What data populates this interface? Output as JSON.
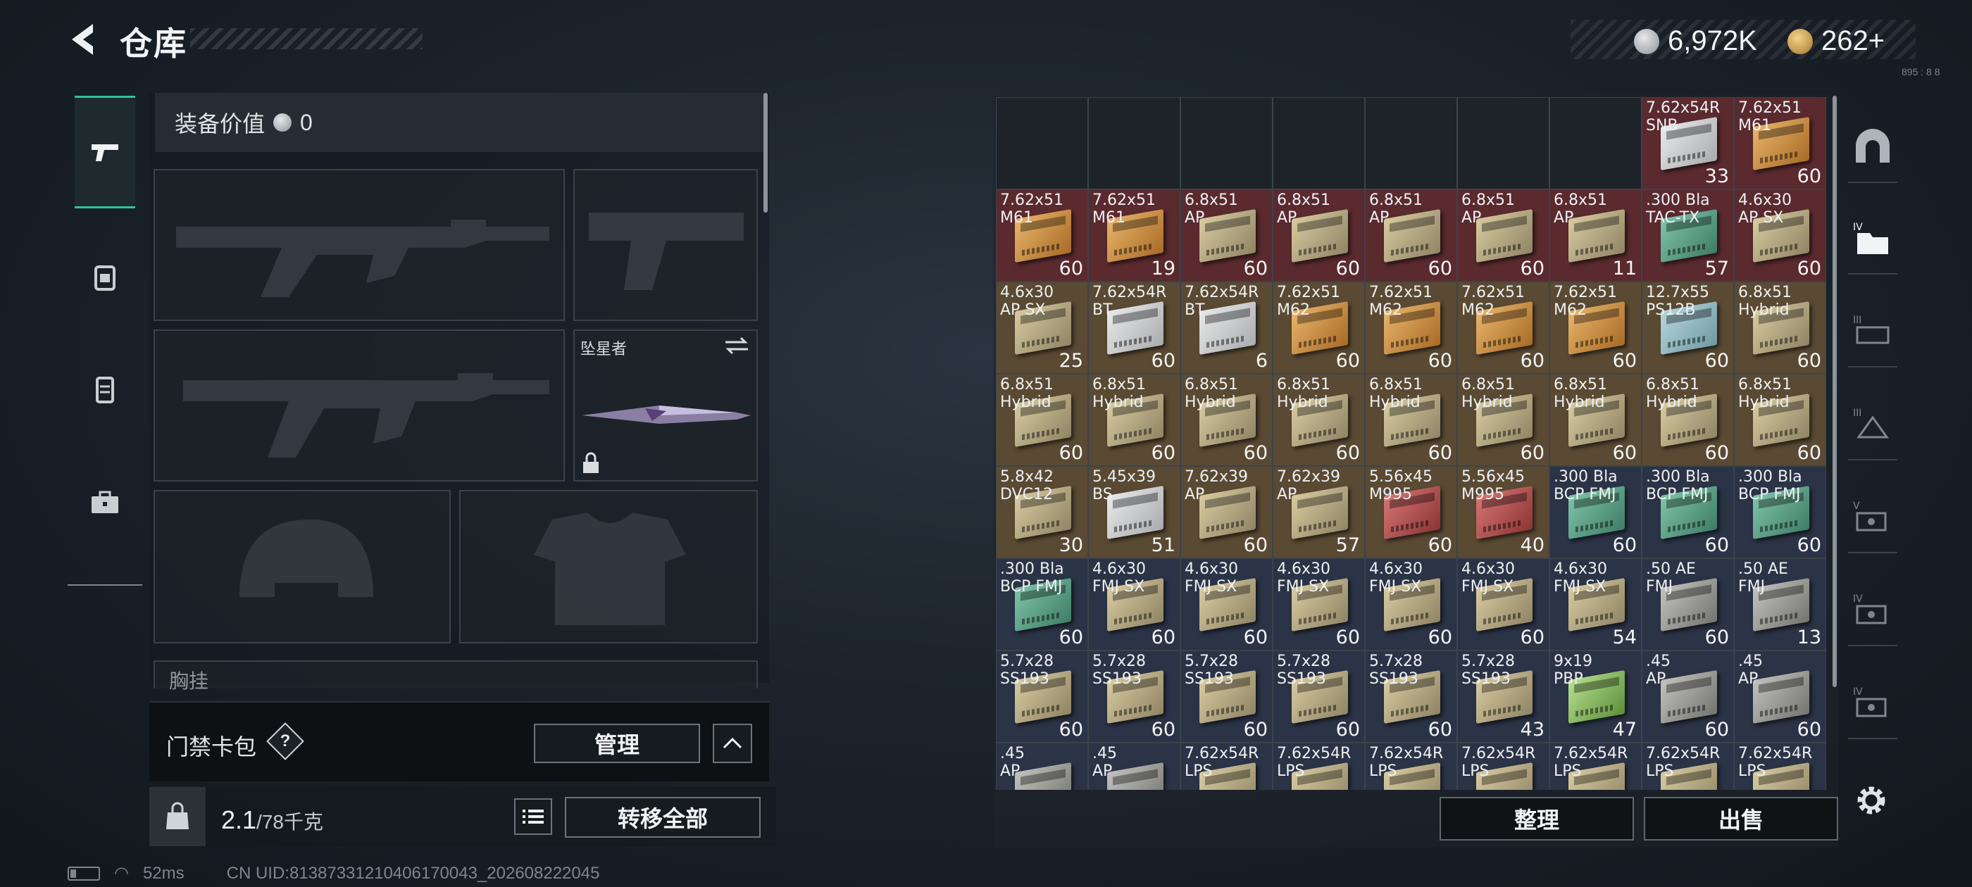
{
  "header": {
    "title": "仓库",
    "currency_silver": "6,972K",
    "currency_gold": "262+",
    "tiny_code": "895 : 8 8"
  },
  "loadout": {
    "value_label": "装备价值",
    "value_amount": "0",
    "melee_name": "坠星者",
    "chest_label": "胸挂",
    "chest_hint": "?"
  },
  "keycard": {
    "label": "门禁卡包",
    "help": "?",
    "manage_label": "管理"
  },
  "weight": {
    "current": "2.1",
    "max": "/78千克",
    "transfer_all_label": "转移全部"
  },
  "status": {
    "ping": "52ms",
    "uid": "CN UID:81387331210406170043_202608222045"
  },
  "stash": {
    "sort_label": "整理",
    "sell_label": "出售",
    "colors": {
      "empty": "#1d2329",
      "red": "#5a2a2e",
      "gold": "#5a4a33",
      "blue": "#2b3346"
    },
    "rows": [
      [
        {
          "name": "",
          "qty": "",
          "bg": "empty",
          "box": ""
        },
        {
          "name": "",
          "qty": "",
          "bg": "empty",
          "box": ""
        },
        {
          "name": "",
          "qty": "",
          "bg": "empty",
          "box": ""
        },
        {
          "name": "",
          "qty": "",
          "bg": "empty",
          "box": ""
        },
        {
          "name": "",
          "qty": "",
          "bg": "empty",
          "box": ""
        },
        {
          "name": "",
          "qty": "",
          "bg": "empty",
          "box": ""
        },
        {
          "name": "",
          "qty": "",
          "bg": "empty",
          "box": ""
        },
        {
          "name": "7.62x54R\nSNB",
          "qty": "33",
          "bg": "red",
          "box": "white"
        },
        {
          "name": "7.62x51\nM61",
          "qty": "60",
          "bg": "red",
          "box": "orange"
        }
      ],
      [
        {
          "name": "7.62x51\nM61",
          "qty": "60",
          "bg": "red",
          "box": "orange"
        },
        {
          "name": "7.62x51\nM61",
          "qty": "19",
          "bg": "red",
          "box": "orange"
        },
        {
          "name": "6.8x51\nAP",
          "qty": "60",
          "bg": "red",
          "box": "tan"
        },
        {
          "name": "6.8x51\nAP",
          "qty": "60",
          "bg": "red",
          "box": "tan"
        },
        {
          "name": "6.8x51\nAP",
          "qty": "60",
          "bg": "red",
          "box": "tan"
        },
        {
          "name": "6.8x51\nAP",
          "qty": "60",
          "bg": "red",
          "box": "tan"
        },
        {
          "name": "6.8x51\nAP",
          "qty": "11",
          "bg": "red",
          "box": "tan"
        },
        {
          "name": ".300 Bla\nTAC-TX",
          "qty": "57",
          "bg": "red",
          "box": "teal"
        },
        {
          "name": "4.6x30\nAP SX",
          "qty": "60",
          "bg": "red",
          "box": "tan"
        }
      ],
      [
        {
          "name": "4.6x30\nAP SX",
          "qty": "25",
          "bg": "gold",
          "box": "tan"
        },
        {
          "name": "7.62x54R\nBT",
          "qty": "60",
          "bg": "gold",
          "box": "white"
        },
        {
          "name": "7.62x54R\nBT",
          "qty": "6",
          "bg": "gold",
          "box": "white"
        },
        {
          "name": "7.62x51\nM62",
          "qty": "60",
          "bg": "gold",
          "box": "orange"
        },
        {
          "name": "7.62x51\nM62",
          "qty": "60",
          "bg": "gold",
          "box": "orange"
        },
        {
          "name": "7.62x51\nM62",
          "qty": "60",
          "bg": "gold",
          "box": "orange"
        },
        {
          "name": "7.62x51\nM62",
          "qty": "60",
          "bg": "gold",
          "box": "orange"
        },
        {
          "name": "12.7x55\nPS12B",
          "qty": "60",
          "bg": "gold",
          "box": "lightblue"
        },
        {
          "name": "6.8x51\nHybrid",
          "qty": "60",
          "bg": "gold",
          "box": "tan"
        }
      ],
      [
        {
          "name": "6.8x51\nHybrid",
          "qty": "60",
          "bg": "gold",
          "box": "tan"
        },
        {
          "name": "6.8x51\nHybrid",
          "qty": "60",
          "bg": "gold",
          "box": "tan"
        },
        {
          "name": "6.8x51\nHybrid",
          "qty": "60",
          "bg": "gold",
          "box": "tan"
        },
        {
          "name": "6.8x51\nHybrid",
          "qty": "60",
          "bg": "gold",
          "box": "tan"
        },
        {
          "name": "6.8x51\nHybrid",
          "qty": "60",
          "bg": "gold",
          "box": "tan"
        },
        {
          "name": "6.8x51\nHybrid",
          "qty": "60",
          "bg": "gold",
          "box": "tan"
        },
        {
          "name": "6.8x51\nHybrid",
          "qty": "60",
          "bg": "gold",
          "box": "tan"
        },
        {
          "name": "6.8x51\nHybrid",
          "qty": "60",
          "bg": "gold",
          "box": "tan"
        },
        {
          "name": "6.8x51\nHybrid",
          "qty": "60",
          "bg": "gold",
          "box": "tan"
        }
      ],
      [
        {
          "name": "5.8x42\nDVC12",
          "qty": "30",
          "bg": "gold",
          "box": "tan"
        },
        {
          "name": "5.45x39\nBS",
          "qty": "51",
          "bg": "gold",
          "box": "white"
        },
        {
          "name": "7.62x39\nAP",
          "qty": "60",
          "bg": "gold",
          "box": "tan"
        },
        {
          "name": "7.62x39\nAP",
          "qty": "57",
          "bg": "gold",
          "box": "tan"
        },
        {
          "name": "5.56x45\nM995",
          "qty": "60",
          "bg": "gold",
          "box": "red"
        },
        {
          "name": "5.56x45\nM995",
          "qty": "40",
          "bg": "gold",
          "box": "red"
        },
        {
          "name": ".300 Bla\nBCP FMJ",
          "qty": "60",
          "bg": "blue",
          "box": "teal"
        },
        {
          "name": ".300 Bla\nBCP FMJ",
          "qty": "60",
          "bg": "blue",
          "box": "teal"
        },
        {
          "name": ".300 Bla\nBCP FMJ",
          "qty": "60",
          "bg": "blue",
          "box": "teal"
        }
      ],
      [
        {
          "name": ".300 Bla\nBCP FMJ",
          "qty": "60",
          "bg": "blue",
          "box": "teal"
        },
        {
          "name": "4.6x30\nFMJ SX",
          "qty": "60",
          "bg": "blue",
          "box": "tan"
        },
        {
          "name": "4.6x30\nFMJ SX",
          "qty": "60",
          "bg": "blue",
          "box": "tan"
        },
        {
          "name": "4.6x30\nFMJ SX",
          "qty": "60",
          "bg": "blue",
          "box": "tan"
        },
        {
          "name": "4.6x30\nFMJ SX",
          "qty": "60",
          "bg": "blue",
          "box": "tan"
        },
        {
          "name": "4.6x30\nFMJ SX",
          "qty": "60",
          "bg": "blue",
          "box": "tan"
        },
        {
          "name": "4.6x30\nFMJ SX",
          "qty": "54",
          "bg": "blue",
          "box": "tan"
        },
        {
          "name": ".50 AE\nFMJ",
          "qty": "60",
          "bg": "blue",
          "box": "gray"
        },
        {
          "name": ".50 AE\nFMJ",
          "qty": "13",
          "bg": "blue",
          "box": "gray"
        }
      ],
      [
        {
          "name": "5.7x28\nSS193",
          "qty": "60",
          "bg": "blue",
          "box": "tan"
        },
        {
          "name": "5.7x28\nSS193",
          "qty": "60",
          "bg": "blue",
          "box": "tan"
        },
        {
          "name": "5.7x28\nSS193",
          "qty": "60",
          "bg": "blue",
          "box": "tan"
        },
        {
          "name": "5.7x28\nSS193",
          "qty": "60",
          "bg": "blue",
          "box": "tan"
        },
        {
          "name": "5.7x28\nSS193",
          "qty": "60",
          "bg": "blue",
          "box": "tan"
        },
        {
          "name": "5.7x28\nSS193",
          "qty": "43",
          "bg": "blue",
          "box": "tan"
        },
        {
          "name": "9x19\nPBP",
          "qty": "47",
          "bg": "blue",
          "box": "green"
        },
        {
          "name": ".45\nAP",
          "qty": "60",
          "bg": "blue",
          "box": "gray"
        },
        {
          "name": ".45\nAP",
          "qty": "60",
          "bg": "blue",
          "box": "gray"
        }
      ],
      [
        {
          "name": ".45\nAP",
          "qty": "",
          "bg": "blue",
          "box": "gray"
        },
        {
          "name": ".45\nAP",
          "qty": "",
          "bg": "blue",
          "box": "gray"
        },
        {
          "name": "7.62x54R\nLPS",
          "qty": "",
          "bg": "blue",
          "box": "tan"
        },
        {
          "name": "7.62x54R\nLPS",
          "qty": "",
          "bg": "blue",
          "box": "tan"
        },
        {
          "name": "7.62x54R\nLPS",
          "qty": "",
          "bg": "blue",
          "box": "tan"
        },
        {
          "name": "7.62x54R\nLPS",
          "qty": "",
          "bg": "blue",
          "box": "tan"
        },
        {
          "name": "7.62x54R\nLPS",
          "qty": "",
          "bg": "blue",
          "box": "tan"
        },
        {
          "name": "7.62x54R\nLPS",
          "qty": "",
          "bg": "blue",
          "box": "tan"
        },
        {
          "name": "7.62x54R\nLPS",
          "qty": "",
          "bg": "blue",
          "box": "tan"
        }
      ]
    ]
  }
}
